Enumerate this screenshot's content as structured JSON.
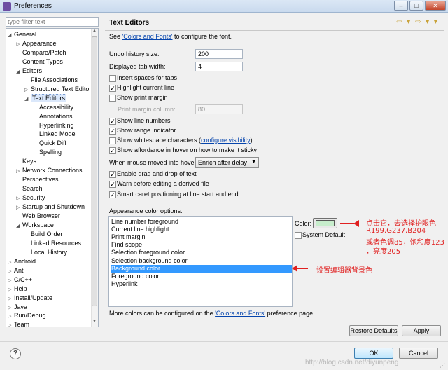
{
  "window": {
    "title": "Preferences",
    "controls": {
      "minimize": "–",
      "maximize": "□",
      "close": "✕"
    }
  },
  "sidebar": {
    "filter_placeholder": "type filter text",
    "items": [
      {
        "label": "General",
        "toggle": "◢",
        "depth": 0
      },
      {
        "label": "Appearance",
        "toggle": "▷",
        "depth": 1
      },
      {
        "label": "Compare/Patch",
        "toggle": "",
        "depth": 1
      },
      {
        "label": "Content Types",
        "toggle": "",
        "depth": 1
      },
      {
        "label": "Editors",
        "toggle": "◢",
        "depth": 1
      },
      {
        "label": "File Associations",
        "toggle": "",
        "depth": 2
      },
      {
        "label": "Structured Text Edito",
        "toggle": "▷",
        "depth": 2
      },
      {
        "label": "Text Editors",
        "toggle": "◢",
        "depth": 2,
        "selected": true
      },
      {
        "label": "Accessibility",
        "toggle": "",
        "depth": 3
      },
      {
        "label": "Annotations",
        "toggle": "",
        "depth": 3
      },
      {
        "label": "Hyperlinking",
        "toggle": "",
        "depth": 3
      },
      {
        "label": "Linked Mode",
        "toggle": "",
        "depth": 3
      },
      {
        "label": "Quick Diff",
        "toggle": "",
        "depth": 3
      },
      {
        "label": "Spelling",
        "toggle": "",
        "depth": 3
      },
      {
        "label": "Keys",
        "toggle": "",
        "depth": 1
      },
      {
        "label": "Network Connections",
        "toggle": "▷",
        "depth": 1
      },
      {
        "label": "Perspectives",
        "toggle": "",
        "depth": 1
      },
      {
        "label": "Search",
        "toggle": "",
        "depth": 1
      },
      {
        "label": "Security",
        "toggle": "▷",
        "depth": 1
      },
      {
        "label": "Startup and Shutdown",
        "toggle": "▷",
        "depth": 1
      },
      {
        "label": "Web Browser",
        "toggle": "",
        "depth": 1
      },
      {
        "label": "Workspace",
        "toggle": "◢",
        "depth": 1
      },
      {
        "label": "Build Order",
        "toggle": "",
        "depth": 2
      },
      {
        "label": "Linked Resources",
        "toggle": "",
        "depth": 2
      },
      {
        "label": "Local History",
        "toggle": "",
        "depth": 2
      },
      {
        "label": "Android",
        "toggle": "▷",
        "depth": 0
      },
      {
        "label": "Ant",
        "toggle": "▷",
        "depth": 0
      },
      {
        "label": "C/C++",
        "toggle": "▷",
        "depth": 0
      },
      {
        "label": "Help",
        "toggle": "▷",
        "depth": 0
      },
      {
        "label": "Install/Update",
        "toggle": "▷",
        "depth": 0
      },
      {
        "label": "Java",
        "toggle": "▷",
        "depth": 0
      },
      {
        "label": "Run/Debug",
        "toggle": "▷",
        "depth": 0
      },
      {
        "label": "Team",
        "toggle": "▷",
        "depth": 0
      }
    ]
  },
  "page": {
    "title": "Text Editors",
    "nav_icons": "⇦ ▾ ⇨ ▾ ▾",
    "see_prefix": "See ",
    "see_link": "'Colors and Fonts'",
    "see_suffix": " to configure the font.",
    "undo_label": "Undo history size:",
    "undo_value": "200",
    "tab_label": "Displayed tab width:",
    "tab_value": "4",
    "insert_spaces": "Insert spaces for tabs",
    "highlight_line": "Highlight current line",
    "show_margin": "Show print margin",
    "margin_col_label": "Print margin column:",
    "margin_col_value": "80",
    "line_numbers": "Show line numbers",
    "range_indicator": "Show range indicator",
    "whitespace_prefix": "Show whitespace characters (",
    "whitespace_link": "configure visibility",
    "whitespace_suffix": ")",
    "affordance": "Show affordance in hover on how to make it sticky",
    "hover_label": "When mouse moved into hover:",
    "hover_value": "Enrich after delay",
    "drag_drop": "Enable drag and drop of text",
    "warn_derived": "Warn before editing a derived file",
    "smart_caret": "Smart caret positioning at line start and end",
    "appearance_label": "Appearance color options:",
    "color_options": [
      "Line number foreground",
      "Current line highlight",
      "Print margin",
      "Find scope",
      "Selection foreground color",
      "Selection background color",
      "Background color",
      "Foreground color",
      "Hyperlink"
    ],
    "selected_option": "Background color",
    "color_label": "Color:",
    "swatch_color": "#c7edcc",
    "system_default": "System Default",
    "more_prefix": "More colors can be configured on the ",
    "more_link": "'Colors and Fonts'",
    "more_suffix": " preference page.",
    "restore_defaults": "Restore Defaults",
    "apply": "Apply"
  },
  "dialog": {
    "help": "?",
    "ok": "OK",
    "cancel": "Cancel"
  },
  "annotations": {
    "note1_line1": "点击它，去选择护眼色",
    "note1_line2": "R199,G237,B204",
    "note1_line3": "或者色调85，饱和度123",
    "note1_line4": "，亮度205",
    "note2": "设置编辑器背景色",
    "color": "#e02020"
  },
  "watermark": "http://blog.csdn.net/diyunpeng"
}
